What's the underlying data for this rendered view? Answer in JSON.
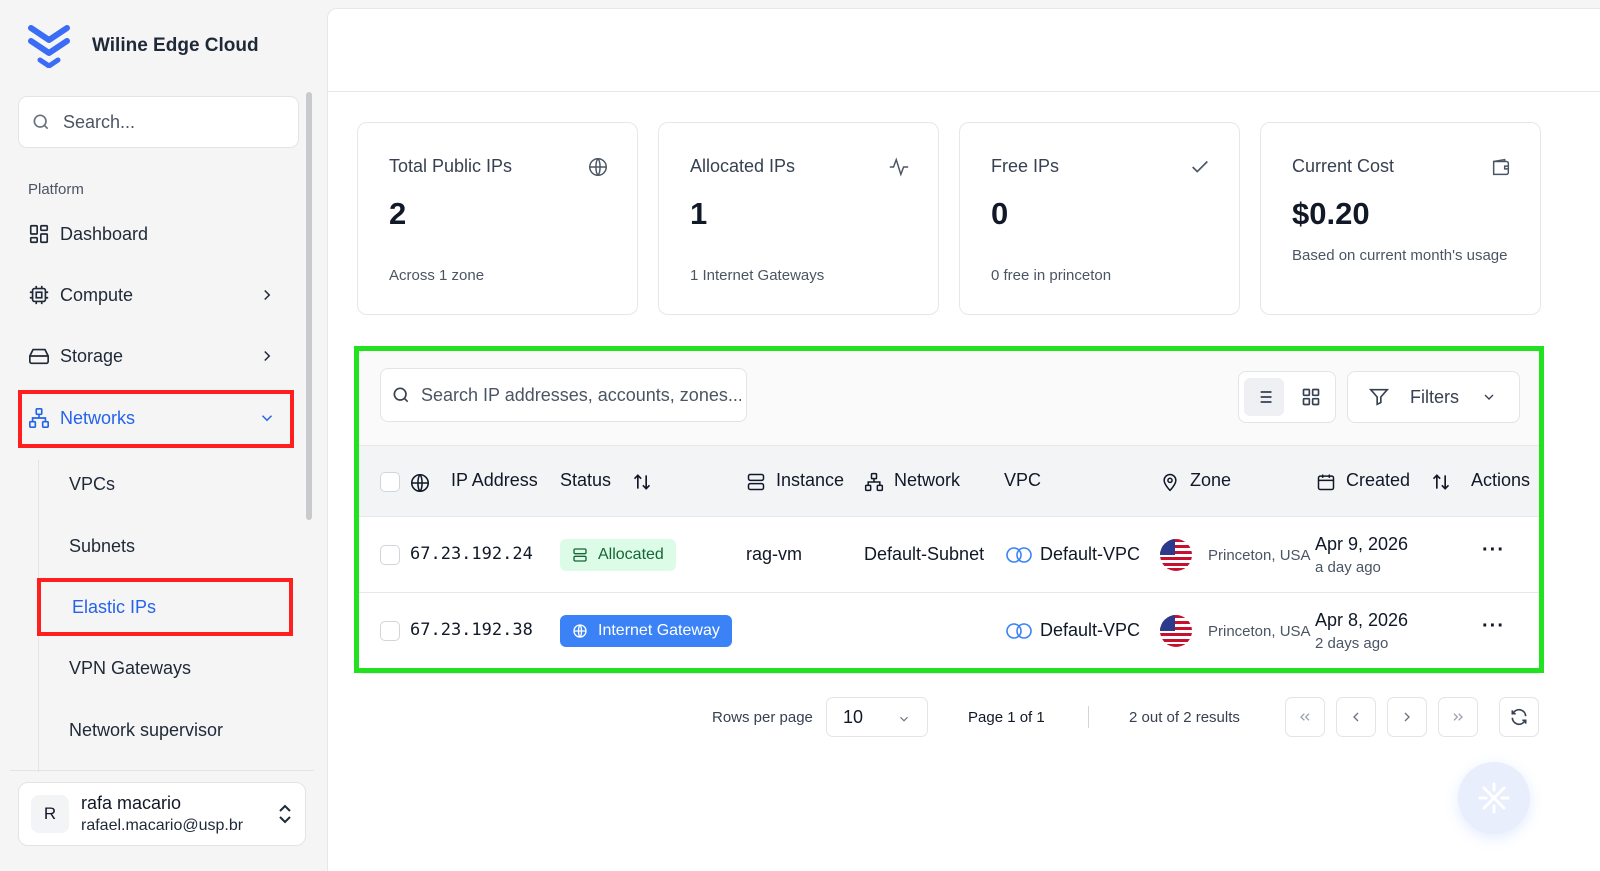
{
  "app": {
    "name": "Wiline Edge Cloud"
  },
  "sidebar": {
    "search_placeholder": "Search...",
    "section_label": "Platform",
    "items": [
      {
        "label": "Dashboard",
        "icon": "dashboard-grid-icon"
      },
      {
        "label": "Compute",
        "icon": "cpu-icon"
      },
      {
        "label": "Storage",
        "icon": "hard-drive-icon"
      },
      {
        "label": "Networks",
        "icon": "network-icon"
      }
    ],
    "network_subitems": [
      "VPCs",
      "Subnets",
      "Elastic IPs",
      "VPN Gateways",
      "Network supervisor"
    ],
    "active_subitem": "Elastic IPs",
    "user": {
      "initial": "R",
      "name": "rafa macario",
      "email": "rafael.macario@usp.br"
    }
  },
  "stats": [
    {
      "title": "Total Public IPs",
      "value": "2",
      "sub": "Across 1 zone",
      "icon": "globe-icon"
    },
    {
      "title": "Allocated IPs",
      "value": "1",
      "sub": "1 Internet Gateways",
      "icon": "activity-icon"
    },
    {
      "title": "Free IPs",
      "value": "0",
      "sub": "0 free in princeton",
      "icon": "check-icon"
    },
    {
      "title": "Current Cost",
      "value": "$0.20",
      "sub": "Based on current month's usage",
      "icon": "wallet-icon"
    }
  ],
  "table": {
    "search_placeholder": "Search IP addresses, accounts, zones...",
    "filters_label": "Filters",
    "columns": [
      "IP Address",
      "Status",
      "Instance",
      "Network",
      "VPC",
      "Zone",
      "Created",
      "Actions"
    ],
    "rows": [
      {
        "ip": "67.23.192.24",
        "status": "Allocated",
        "instance": "rag-vm",
        "network": "Default-Subnet",
        "vpc": "Default-VPC",
        "zone": "Princeton, USA",
        "created": "Apr 9, 2026",
        "created_rel": "a day ago",
        "actions": "···"
      },
      {
        "ip": "67.23.192.38",
        "status": "Internet Gateway",
        "instance": "",
        "network": "",
        "vpc": "Default-VPC",
        "zone": "Princeton, USA",
        "created": "Apr 8, 2026",
        "created_rel": "2 days ago",
        "actions": "···"
      }
    ]
  },
  "pagination": {
    "rows_per_page_label": "Rows per page",
    "rows_per_page_value": "10",
    "page_label": "Page 1 of 1",
    "results_label": "2 out of 2 results"
  },
  "colors": {
    "accent": "#2563eb",
    "highlight_red": "#ff1f1f",
    "highlight_green": "#22e11f",
    "allocated_bg": "#dcfce7",
    "gateway_bg": "#3b82f6"
  }
}
